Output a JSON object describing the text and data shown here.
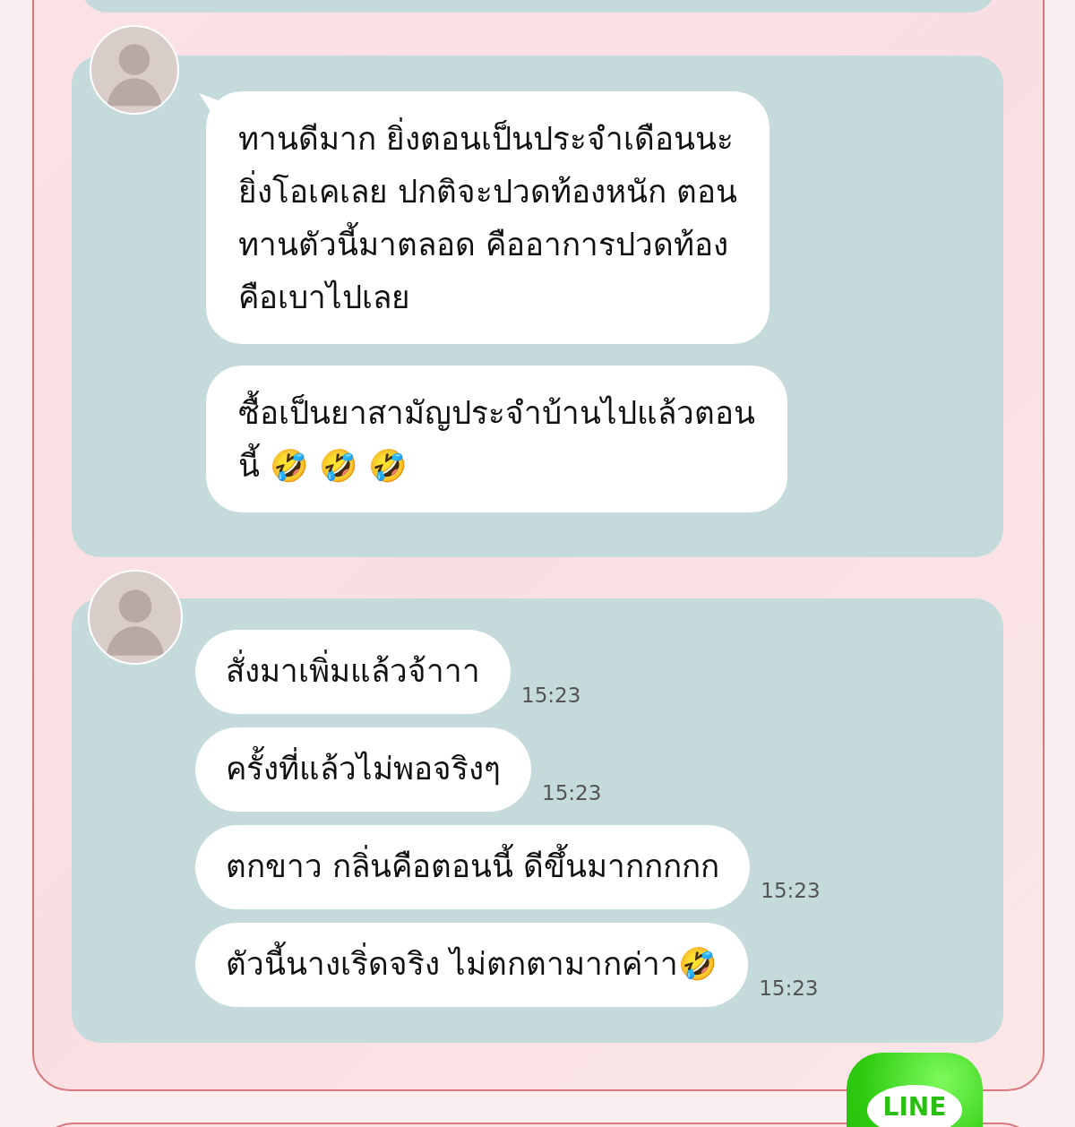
{
  "conversations": [
    {
      "kind": "tail",
      "messages": [
        {
          "text": "ทานดีมาก ยิ่งตอนเป็นประจำเดือนนะ\nยิ่งโอเคเลย ปกติจะปวดท้องหนัก ตอน\nทานตัวนี้มาตลอด  คืออาการปวดท้อง\nคือเบาไปเลย"
        },
        {
          "text": "ซื้อเป็นยาสามัญประจำบ้านไปแล้วตอน\nนี้ 🤣 🤣 🤣"
        }
      ]
    },
    {
      "kind": "plain",
      "messages": [
        {
          "text": "สั่งมาเพิ่มแล้วจ้าาา",
          "time": "15:23"
        },
        {
          "text": "ครั้งที่แล้วไม่พอจริงๆ",
          "time": "15:23"
        },
        {
          "text": "ตกขาว กลิ่นคือตอนนี้ ดีขึ้นมากกกกก",
          "time": "15:23"
        },
        {
          "text": "ตัวนี้นางเริ่ดจริง ไม่ตกตามากค่าา🤣",
          "time": "15:23"
        }
      ]
    }
  ],
  "line_badge": {
    "label": "LINE"
  }
}
